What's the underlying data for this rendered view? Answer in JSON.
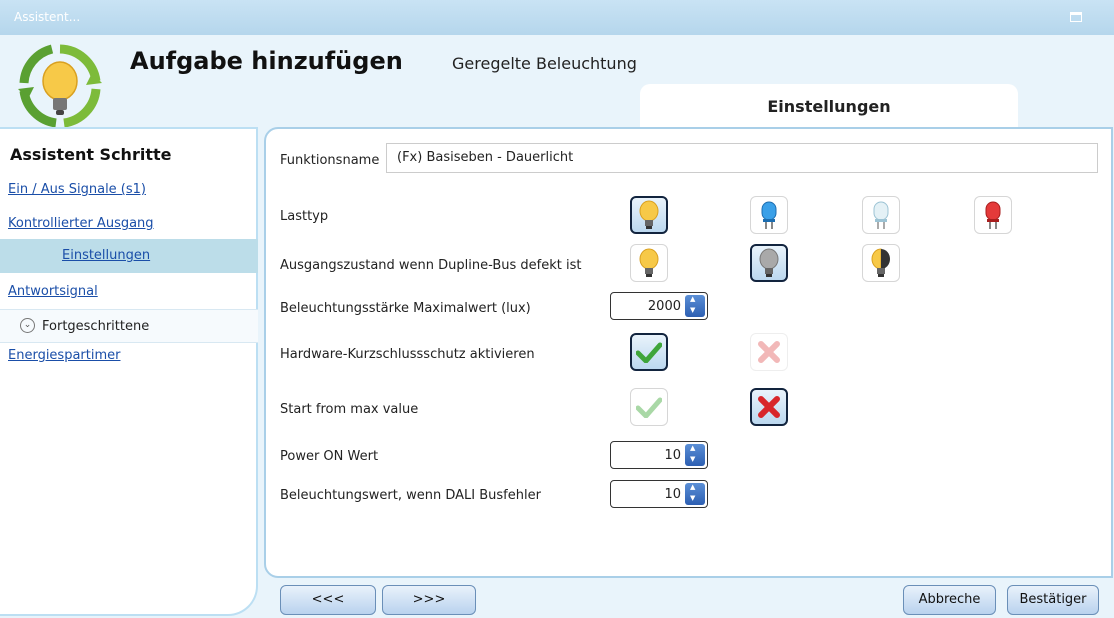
{
  "window": {
    "title": "Assistent..."
  },
  "header": {
    "title": "Aufgabe hinzufügen",
    "subtitle": "Geregelte Beleuchtung",
    "tab": "Einstellungen"
  },
  "sidebar": {
    "title": "Assistent Schritte",
    "items": [
      {
        "label": "Ein / Aus Signale (s1)"
      },
      {
        "label": "Kontrollierter Ausgang"
      },
      {
        "label": "Einstellungen"
      },
      {
        "label": "Antwortsignal"
      },
      {
        "label": "Fortgeschrittene"
      },
      {
        "label": "Energiespartimer"
      }
    ]
  },
  "form": {
    "function_name_label": "Funktionsname",
    "function_name_value": "(Fx) Basiseben - Dauerlicht",
    "load_type_label": "Lasttyp",
    "output_state_label": "Ausgangszustand wenn Dupline-Bus defekt ist",
    "max_lux_label": "Beleuchtungsstärke Maximalwert (lux)",
    "max_lux_value": "2000",
    "short_circuit_label": "Hardware-Kurzschlussschutz aktivieren",
    "start_max_label": "Start from max value",
    "power_on_label": "Power ON Wert",
    "power_on_value": "10",
    "dali_fault_label": "Beleuchtungswert, wenn DALI Busfehler",
    "dali_fault_value": "10"
  },
  "footer": {
    "prev": "<<<",
    "next": ">>>",
    "cancel": "Abbreche",
    "confirm": "Bestätiger"
  },
  "colors": {
    "accent": "#1a4ea8",
    "border": "#a9cfe8",
    "selected": "#12243e"
  }
}
